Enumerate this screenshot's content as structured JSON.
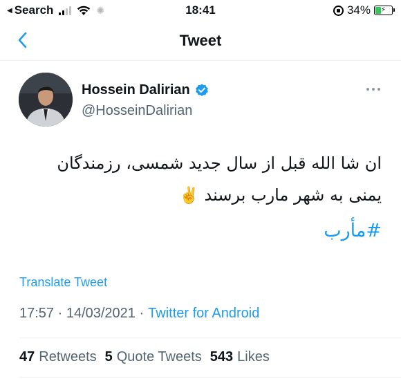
{
  "status_bar": {
    "back_label": "Search",
    "time": "18:41",
    "battery_percent": "34%",
    "battery_level": 0.34,
    "colors": {
      "battery": "#34c759"
    }
  },
  "nav": {
    "title": "Tweet",
    "back_icon": "chevron-left-icon"
  },
  "author": {
    "name": "Hossein Dalirian",
    "handle": "@HosseinDalirian",
    "verified_icon": "verified-badge-icon"
  },
  "tweet": {
    "text_line1": "ان شا الله قبل از سال جدید شمسی، رزمندگان",
    "text_line2": "یمنی به شهر مارب برسند",
    "emoji": "✌️",
    "hashtag": "#مأرب",
    "translate_label": "Translate Tweet",
    "timestamp": "17:57 · 14/03/2021 ·",
    "source": "Twitter for Android"
  },
  "stats": {
    "retweets_count": "47",
    "retweets_label": "Retweets",
    "quotes_count": "5",
    "quotes_label": "Quote Tweets",
    "likes_count": "543",
    "likes_label": "Likes"
  },
  "colors": {
    "accent": "#1d9bf0",
    "text_primary": "#0f1419",
    "text_secondary": "#536471"
  }
}
